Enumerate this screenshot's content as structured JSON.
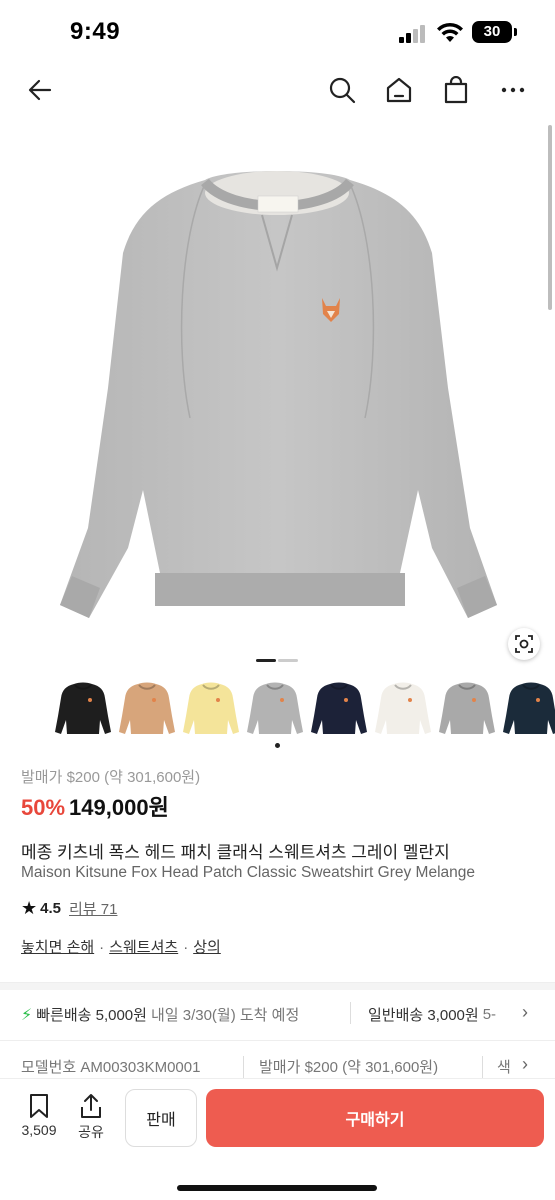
{
  "status_bar": {
    "time": "9:49",
    "battery": "30"
  },
  "nav": {
    "back_icon": "arrow-left-icon",
    "icons": [
      "search-icon",
      "home-icon",
      "shopping-bag-icon",
      "more-icon"
    ]
  },
  "colors": {
    "accent": "#ee5c50",
    "discount": "#e8473b",
    "fast_delivery": "#2bbf4b"
  },
  "gallery": {
    "slides_total": 2,
    "current_slide": 1,
    "thumbnails": [
      {
        "color": "#1e1e1e"
      },
      {
        "color": "#d7a57b"
      },
      {
        "color": "#f4e49a"
      },
      {
        "color": "#b3b3b3"
      },
      {
        "color": "#1c2238"
      },
      {
        "color": "#f2efe9"
      },
      {
        "color": "#a9a9a9"
      },
      {
        "color": "#1b2b3a"
      }
    ],
    "selected_thumbnail": 4
  },
  "product": {
    "release_price": "발매가 $200 (약 301,600원)",
    "discount": "50%",
    "price": "149,000원",
    "title_ko": "메종 키츠네 폭스 헤드 패치 클래식 스웨트셔츠 그레이 멜란지",
    "title_en": "Maison Kitsune Fox Head Patch Classic Sweatshirt Grey Melange",
    "rating": "4.5",
    "review": "리뷰 71",
    "tags": [
      "놓치면 손해",
      "스웨트셔츠",
      "상의"
    ]
  },
  "delivery": {
    "fast_label": "빠른배송 5,000원",
    "fast_eta": "내일 3/30(월) 도착 예정",
    "normal_label": "일반배송 3,000원",
    "normal_eta": "5-"
  },
  "specs": {
    "model": "모델번호 AM00303KM0001",
    "release": "발매가 $200 (약 301,600원)",
    "color": "색"
  },
  "bottom_bar": {
    "bookmark_count": "3,509",
    "share_label": "공유",
    "sell_label": "판매",
    "buy_label": "구매하기"
  }
}
